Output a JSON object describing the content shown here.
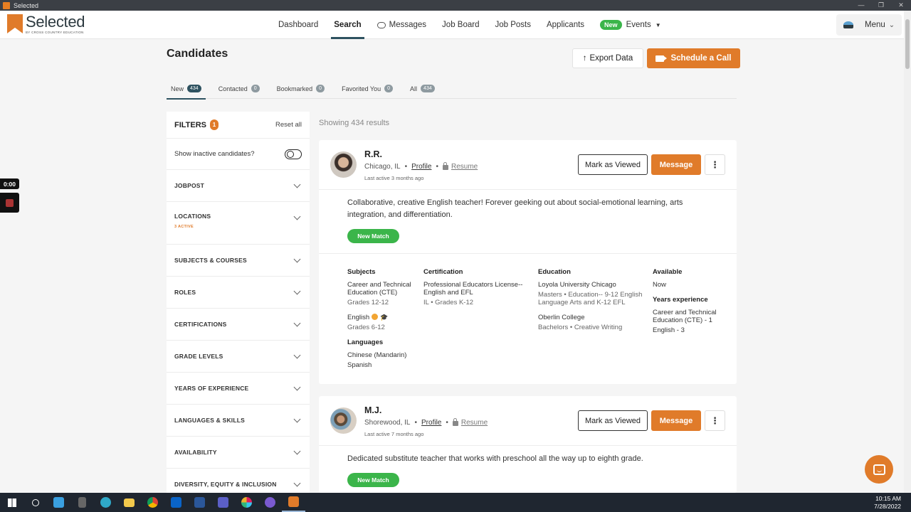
{
  "window": {
    "title": "Selected"
  },
  "brand": {
    "name": "Selected",
    "tagline": "BY CROSS COUNTRY EDUCATION",
    "accent": "#e07b2a",
    "dark": "#2e5260"
  },
  "nav": {
    "items": [
      "Dashboard",
      "Search",
      "Messages",
      "Job Board",
      "Job Posts",
      "Applicants"
    ],
    "events_badge": "New",
    "events_label": "Events",
    "menu_label": "Menu"
  },
  "recorder": {
    "time": "0:00"
  },
  "page": {
    "title": "Candidates",
    "export_label": "Export Data",
    "schedule_label": "Schedule a Call",
    "showing": "Showing 434 results"
  },
  "tabs": [
    {
      "label": "New",
      "count": "434"
    },
    {
      "label": "Contacted",
      "count": "0"
    },
    {
      "label": "Bookmarked",
      "count": "0"
    },
    {
      "label": "Favorited You",
      "count": "0"
    },
    {
      "label": "All",
      "count": "434"
    }
  ],
  "filters": {
    "title": "FILTERS",
    "count": "1",
    "reset": "Reset all",
    "inactive_label": "Show inactive candidates?",
    "items": [
      {
        "label": "JOBPOST",
        "sub": ""
      },
      {
        "label": "LOCATIONS",
        "sub": "3 ACTIVE"
      },
      {
        "label": "SUBJECTS & COURSES",
        "sub": ""
      },
      {
        "label": "ROLES",
        "sub": ""
      },
      {
        "label": "CERTIFICATIONS",
        "sub": ""
      },
      {
        "label": "GRADE LEVELS",
        "sub": ""
      },
      {
        "label": "YEARS OF EXPERIENCE",
        "sub": ""
      },
      {
        "label": "LANGUAGES & SKILLS",
        "sub": ""
      },
      {
        "label": "AVAILABILITY",
        "sub": ""
      },
      {
        "label": "DIVERSITY, EQUITY & INCLUSION",
        "sub": ""
      }
    ]
  },
  "card_labels": {
    "mark_viewed": "Mark as Viewed",
    "message": "Message",
    "more": "⋮",
    "profile": "Profile",
    "resume": "Resume",
    "new_match": "New Match",
    "subjects": "Subjects",
    "languages": "Languages",
    "certification": "Certification",
    "education": "Education",
    "available": "Available",
    "years_experience": "Years experience"
  },
  "candidates": [
    {
      "name": "R.R.",
      "location": "Chicago, IL",
      "last_active": "Last active 3 months ago",
      "bio": "Collaborative, creative English teacher! Forever geeking out about social-emotional learning, arts integration, and differentiation.",
      "subjects": [
        {
          "name": "Career and Technical Education (CTE)",
          "grades": "Grades 12-12"
        },
        {
          "name": "English",
          "grades": "Grades 6-12"
        }
      ],
      "languages": [
        "Chinese (Mandarin)",
        "Spanish"
      ],
      "certification": {
        "name": "Professional Educators License--English and EFL",
        "detail": "IL • Grades K-12"
      },
      "education": [
        {
          "school": "Loyola University Chicago",
          "detail": "Masters • Education-- 9-12 English Language Arts and K-12 EFL"
        },
        {
          "school": "Oberlin College",
          "detail": "Bachelors • Creative Writing"
        }
      ],
      "available": "Now",
      "experience": [
        "Career and Technical Education (CTE) - 1",
        "English - 3"
      ]
    },
    {
      "name": "M.J.",
      "location": "Shorewood, IL",
      "last_active": "Last active 7 months ago",
      "bio": "Dedicated substitute teacher that works with preschool all the way up to eighth grade."
    }
  ],
  "taskbar": {
    "time": "10:15 AM",
    "date": "7/28/2022"
  }
}
